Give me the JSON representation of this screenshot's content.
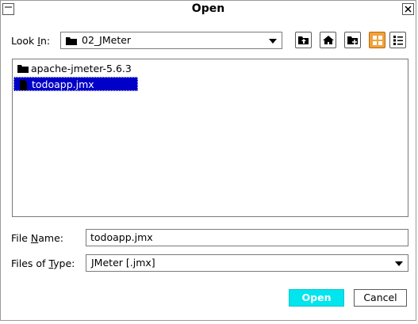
{
  "window": {
    "title": "Open"
  },
  "look_in": {
    "label_prefix": "Look ",
    "label_mnemonic": "I",
    "label_suffix": "n:",
    "value": "02_JMeter"
  },
  "toolbar": {
    "up_folder_icon": "up-folder-icon",
    "home_icon": "home-icon",
    "new_folder_icon": "new-folder-icon",
    "list_view_icon": "list-view-icon",
    "details_view_icon": "details-view-icon"
  },
  "files": [
    {
      "name": "apache-jmeter-5.6.3",
      "type": "folder",
      "selected": false
    },
    {
      "name": "todoapp.jmx",
      "type": "file",
      "selected": true
    }
  ],
  "file_name": {
    "label_prefix": "File ",
    "label_mnemonic": "N",
    "label_suffix": "ame:",
    "value": "todoapp.jmx"
  },
  "file_type": {
    "label_prefix": "Files of ",
    "label_mnemonic": "T",
    "label_suffix": "ype:",
    "value": "JMeter [.jmx]"
  },
  "buttons": {
    "open": "Open",
    "cancel": "Cancel"
  },
  "colors": {
    "selection": "#0000c8",
    "open_button": "#00e5ee",
    "active_toggle": "#f0a23c"
  }
}
